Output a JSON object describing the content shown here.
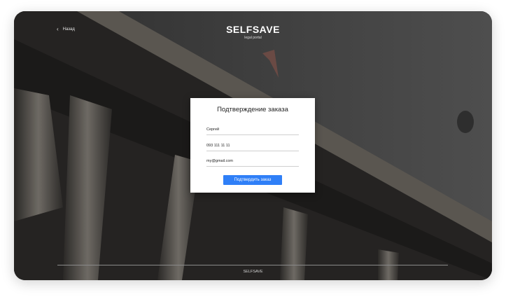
{
  "header": {
    "back_label": "Назад",
    "brand_title": "SELFSAVE",
    "brand_subtitle": "legal portal"
  },
  "form": {
    "title": "Подтверждение заказа",
    "name_value": "Сергей",
    "phone_value": "093 111 11 11",
    "email_value": "my@gmail.com",
    "submit_label": "Подтвердить заказ"
  },
  "footer": {
    "brand": "SELFSAVE"
  },
  "colors": {
    "accent": "#2f7ff7",
    "background_overlay": "#3c3c3c"
  }
}
